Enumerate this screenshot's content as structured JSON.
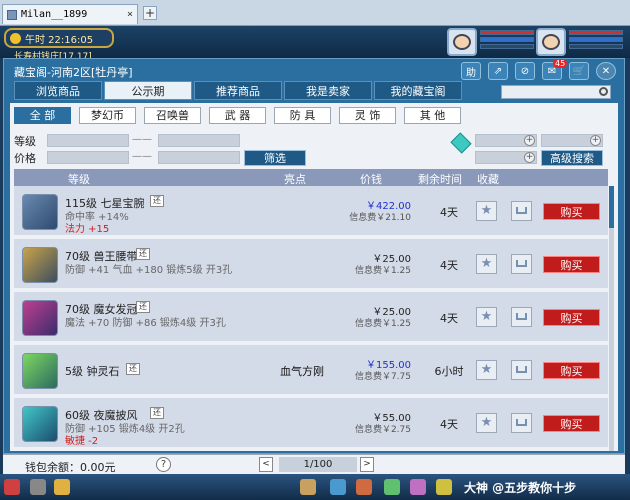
{
  "browser": {
    "tab_title": "Milan__1899",
    "add_tab": "+",
    "close_tab": "×"
  },
  "hud": {
    "clock": "午时  22:16:05",
    "location": "长寿村钱庄[17,17]"
  },
  "panel": {
    "title": "藏宝阁-河南2区[牡丹亭]",
    "top_icons": [
      "助",
      "⇗",
      "⊘",
      "✉",
      "🛒",
      "✕"
    ],
    "mail_count": "45"
  },
  "nav_tabs": [
    "浏览商品",
    "公示期",
    "推荐商品",
    "我是卖家",
    "我的藏宝阁"
  ],
  "categories": [
    "全 部",
    "梦幻币",
    "召唤兽",
    "武 器",
    "防 具",
    "灵 饰",
    "其 他"
  ],
  "filters": {
    "level_label": "等级",
    "price_label": "价格",
    "dash": "——",
    "filter_button": "筛选",
    "advanced_button": "高级搜索",
    "plus": "+"
  },
  "table": {
    "headers": {
      "level": "等级",
      "highlight": "亮点",
      "price": "价钱",
      "remaining": "剩余时间",
      "favorite": "收藏"
    },
    "rows": [
      {
        "name": "115级 七星宝腕",
        "tag": "还",
        "attr": "命中率 +14%",
        "red": "法力 +15",
        "highlight": "",
        "price": "￥422.00",
        "fee": "信息费￥21.10",
        "remaining": "4天",
        "buy": "购买"
      },
      {
        "name": "70级 兽王腰带",
        "tag": "还",
        "attr": "防御 +41 气血 +180 锻炼5级 开3孔",
        "red": "",
        "highlight": "",
        "price": "￥25.00",
        "fee": "信息费￥1.25",
        "remaining": "4天",
        "buy": "购买"
      },
      {
        "name": "70级 魔女发冠",
        "tag": "还",
        "attr": "魔法 +70 防御 +86 锻炼4级 开3孔",
        "red": "",
        "highlight": "",
        "price": "￥25.00",
        "fee": "信息费￥1.25",
        "remaining": "4天",
        "buy": "购买"
      },
      {
        "name": "5级 钟灵石",
        "tag": "还",
        "attr": "",
        "red": "",
        "highlight": "血气方刚",
        "price": "￥155.00",
        "fee": "信息费￥7.75",
        "remaining": "6小时",
        "buy": "购买"
      },
      {
        "name": "60级 夜魔披风",
        "tag": "还",
        "attr": "防御 +105 锻炼4级 开2孔",
        "red": "敏捷 -2",
        "highlight": "",
        "price": "￥55.00",
        "fee": "信息费￥2.75",
        "remaining": "4天",
        "buy": "购买"
      }
    ]
  },
  "footer": {
    "wallet": "钱包余额：0.00元",
    "help": "?",
    "prev": "<",
    "next": ">",
    "page": "1/100"
  },
  "taskbar": {
    "watermark": "大神 @五步教你十步"
  }
}
